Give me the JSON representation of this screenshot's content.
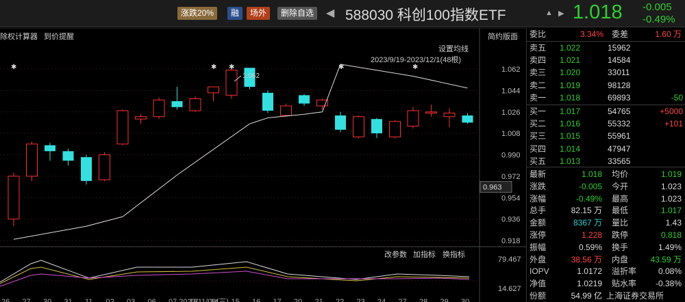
{
  "topbar": {
    "tag_zhangdie": "涨跌20%",
    "tag_rong": "融",
    "tag_changwai": "场外",
    "tag_delete": "删除自选",
    "nav_prev": "◀",
    "title": "588030 科创100指数ETF",
    "nav_bell": "▲",
    "nav_next": "▶",
    "price": "1.018",
    "change": "-0.005",
    "change_pct": "-0.49%"
  },
  "toolbar": {
    "tool1": "除权计算器",
    "tool2": "到价提醒",
    "simple": "简约版面",
    "set_ma": "设置均线",
    "range": "2023/9/19-2023/12/1(48根)",
    "indicator_params": "改参数",
    "add_indicator": "加指标",
    "switch_indicator": "换指标"
  },
  "chart_data": {
    "type": "candlestick",
    "y_ticks": [
      "1.062",
      "1.044",
      "1.026",
      "1.008",
      "0.990",
      "0.972",
      "0.954",
      "0.936",
      "0.918"
    ],
    "ylim": [
      0.909,
      1.071
    ],
    "current_price_label": "0.963",
    "high_annotation": "1.062",
    "x_ticks": [
      "26",
      "27",
      "30",
      "31",
      "11",
      "02",
      "03",
      "06",
      "07 2023/11/08(三)",
      "13",
      "14",
      "15",
      "16",
      "17",
      "20",
      "21",
      "22",
      "23",
      "24",
      "27",
      "28",
      "29",
      "30"
    ],
    "candles": [
      {
        "o": 0.936,
        "h": 0.975,
        "l": 0.93,
        "c": 0.972
      },
      {
        "o": 0.972,
        "h": 1.001,
        "l": 0.968,
        "c": 0.999
      },
      {
        "o": 0.998,
        "h": 1.0,
        "l": 0.985,
        "c": 0.993
      },
      {
        "o": 0.993,
        "h": 0.995,
        "l": 0.981,
        "c": 0.985
      },
      {
        "o": 0.988,
        "h": 0.99,
        "l": 0.965,
        "c": 0.968
      },
      {
        "o": 0.969,
        "h": 0.992,
        "l": 0.968,
        "c": 0.99
      },
      {
        "o": 0.999,
        "h": 1.028,
        "l": 0.998,
        "c": 1.027
      },
      {
        "o": 1.02,
        "h": 1.024,
        "l": 1.016,
        "c": 1.022
      },
      {
        "o": 1.022,
        "h": 1.038,
        "l": 1.02,
        "c": 1.036
      },
      {
        "o": 1.035,
        "h": 1.047,
        "l": 1.028,
        "c": 1.03
      },
      {
        "o": 1.027,
        "h": 1.039,
        "l": 1.026,
        "c": 1.037
      },
      {
        "o": 1.042,
        "h": 1.046,
        "l": 1.035,
        "c": 1.047
      },
      {
        "o": 1.04,
        "h": 1.062,
        "l": 1.037,
        "c": 1.061
      },
      {
        "o": 1.063,
        "h": 1.062,
        "l": 1.045,
        "c": 1.047
      },
      {
        "o": 1.042,
        "h": 1.044,
        "l": 1.025,
        "c": 1.027
      },
      {
        "o": 1.023,
        "h": 1.033,
        "l": 1.022,
        "c": 1.031
      },
      {
        "o": 1.04,
        "h": 1.041,
        "l": 1.031,
        "c": 1.033
      },
      {
        "o": 1.031,
        "h": 1.037,
        "l": 1.028,
        "c": 1.036
      },
      {
        "o": 1.023,
        "h": 1.026,
        "l": 1.009,
        "c": 1.011
      },
      {
        "o": 1.005,
        "h": 1.023,
        "l": 1.004,
        "c": 1.022
      },
      {
        "o": 1.02,
        "h": 1.021,
        "l": 1.004,
        "c": 1.008
      },
      {
        "o": 1.005,
        "h": 1.019,
        "l": 1.004,
        "c": 1.018
      },
      {
        "o": 1.014,
        "h": 1.03,
        "l": 1.012,
        "c": 1.027
      },
      {
        "o": 1.025,
        "h": 1.032,
        "l": 1.022,
        "c": 1.026
      },
      {
        "o": 1.022,
        "h": 1.029,
        "l": 1.013,
        "c": 1.025
      },
      {
        "o": 1.023,
        "h": 1.025,
        "l": 1.016,
        "c": 1.017
      }
    ],
    "ma_line": [
      {
        "i": 0,
        "y": 0.919
      },
      {
        "i": 4,
        "y": 0.93
      },
      {
        "i": 6,
        "y": 0.938
      },
      {
        "i": 9,
        "y": 0.973
      },
      {
        "i": 13,
        "y": 1.016
      },
      {
        "i": 14,
        "y": 1.021
      },
      {
        "i": 16,
        "y": 1.024
      },
      {
        "i": 17,
        "y": 1.026
      },
      {
        "i": 18,
        "y": 1.066
      },
      {
        "i": 22,
        "y": 1.056
      },
      {
        "i": 25,
        "y": 1.046
      }
    ],
    "sub_chart": {
      "y_ticks": [
        "79.467",
        "14.627"
      ]
    }
  },
  "panel": {
    "weibi_label": "委比",
    "weibi": "3.34%",
    "weicha_label": "委差",
    "weicha": "1.60 万",
    "sells": [
      {
        "label": "卖五",
        "price": "1.022",
        "vol": "15962",
        "chg": ""
      },
      {
        "label": "卖四",
        "price": "1.021",
        "vol": "14584",
        "chg": ""
      },
      {
        "label": "卖三",
        "price": "1.020",
        "vol": "33011",
        "chg": ""
      },
      {
        "label": "卖二",
        "price": "1.019",
        "vol": "98128",
        "chg": ""
      },
      {
        "label": "卖一",
        "price": "1.018",
        "vol": "69893",
        "chg": "-50"
      }
    ],
    "buys": [
      {
        "label": "买一",
        "price": "1.017",
        "vol": "54765",
        "chg": "+5000"
      },
      {
        "label": "买二",
        "price": "1.016",
        "vol": "55332",
        "chg": "+101"
      },
      {
        "label": "买三",
        "price": "1.015",
        "vol": "55961",
        "chg": ""
      },
      {
        "label": "买四",
        "price": "1.014",
        "vol": "47947",
        "chg": ""
      },
      {
        "label": "买五",
        "price": "1.013",
        "vol": "33565",
        "chg": ""
      }
    ],
    "stats": [
      {
        "l1": "最新",
        "v1": "1.018",
        "c1": "green",
        "l2": "均价",
        "v2": "1.019",
        "c2": "green"
      },
      {
        "l1": "涨跌",
        "v1": "-0.005",
        "c1": "green",
        "l2": "今开",
        "v2": "1.023",
        "c2": "white"
      },
      {
        "l1": "涨幅",
        "v1": "-0.49%",
        "c1": "green",
        "l2": "最高",
        "v2": "1.023",
        "c2": "white"
      },
      {
        "l1": "总手",
        "v1": "82.15 万",
        "c1": "white",
        "l2": "最低",
        "v2": "1.017",
        "c2": "green"
      },
      {
        "l1": "金额",
        "v1": "8367 万",
        "c1": "cyan",
        "l2": "量比",
        "v2": "1.43",
        "c2": "white"
      },
      {
        "l1": "涨停",
        "v1": "1.228",
        "c1": "red",
        "l2": "跌停",
        "v2": "0.818",
        "c2": "green"
      },
      {
        "l1": "振幅",
        "v1": "0.59%",
        "c1": "white",
        "l2": "换手",
        "v2": "1.49%",
        "c2": "white"
      },
      {
        "l1": "外盘",
        "v1": "38.56 万",
        "c1": "red",
        "l2": "内盘",
        "v2": "43.59 万",
        "c2": "green"
      },
      {
        "l1": "IOPV",
        "v1": "1.0172",
        "c1": "white",
        "l2": "溢折率",
        "v2": "0.08%",
        "c2": "white"
      },
      {
        "l1": "净值",
        "v1": "1.0219",
        "c1": "white",
        "l2": "贴水率",
        "v2": "-0.38%",
        "c2": "white"
      },
      {
        "l1": "份额",
        "v1": "54.99 亿",
        "c1": "white",
        "l2": "上海证券交易所",
        "v2": "",
        "c2": "white"
      }
    ]
  }
}
